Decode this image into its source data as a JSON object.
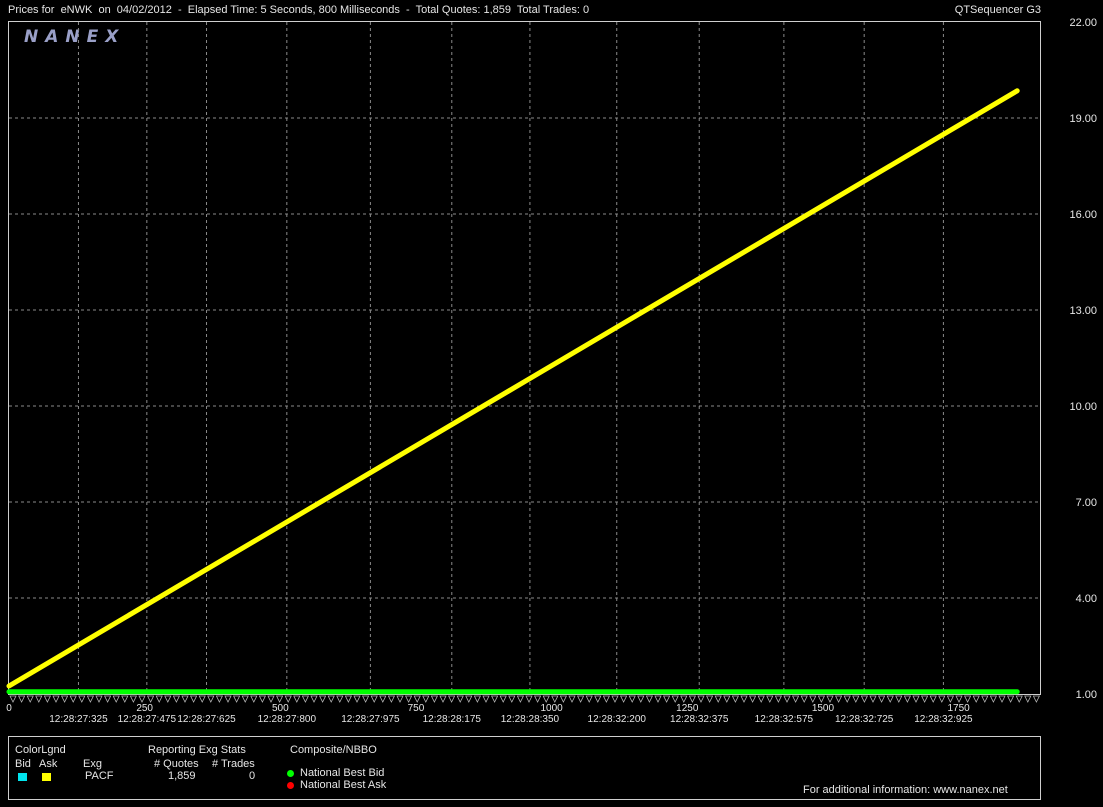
{
  "header": {
    "title": "Prices for  eNWK  on  04/02/2012  -  Elapsed Time: 5 Seconds, 800 Milliseconds  -  Total Quotes: 1,859  Total Trades: 0",
    "app_name": "QTSequencer G3"
  },
  "logo": "NANEX",
  "colors": {
    "ask": "#ffff00",
    "bid": "#00ff00",
    "grid": "#8a8a8a",
    "bid_swatch": "#00e5ee",
    "ask_swatch": "#ffff00",
    "nbb_dot": "#00ff00",
    "nba_dot": "#ff0000"
  },
  "chart_data": {
    "type": "line",
    "x_ticks": [
      0,
      250,
      500,
      750,
      1000,
      1250,
      1500,
      1750
    ],
    "time_labels": [
      {
        "x": 128,
        "label": "12:28:27:325"
      },
      {
        "x": 254,
        "label": "12:28:27:475"
      },
      {
        "x": 364,
        "label": "12:28:27:625"
      },
      {
        "x": 512,
        "label": "12:28:27:800"
      },
      {
        "x": 666,
        "label": "12:28:27:975"
      },
      {
        "x": 816,
        "label": "12:28:28:175"
      },
      {
        "x": 960,
        "label": "12:28:28:350"
      },
      {
        "x": 1120,
        "label": "12:28:32:200"
      },
      {
        "x": 1272,
        "label": "12:28:32:375"
      },
      {
        "x": 1428,
        "label": "12:28:32:575"
      },
      {
        "x": 1576,
        "label": "12:28:32:725"
      },
      {
        "x": 1722,
        "label": "12:28:32:925"
      }
    ],
    "y_ticks": [
      "1.00",
      "4.00",
      "7.00",
      "10.00",
      "13.00",
      "16.00",
      "19.00",
      "22.00"
    ],
    "xlim": [
      0,
      1900
    ],
    "ylim": [
      1,
      22
    ],
    "grid": true,
    "series": [
      {
        "name": "Ask",
        "x": [
          0,
          1858
        ],
        "values": [
          1.25,
          19.85
        ]
      },
      {
        "name": "Bid",
        "x": [
          0,
          1858
        ],
        "values": [
          1.07,
          1.07
        ]
      }
    ]
  },
  "legend": {
    "color_legend": "ColorLgnd",
    "bid": "Bid",
    "ask": "Ask",
    "exg_header": "Exg",
    "exchange": "PACF",
    "reporting_header": "Reporting Exg Stats",
    "quotes_header": "# Quotes",
    "trades_header": "# Trades",
    "quotes_value": "1,859",
    "trades_value": "0",
    "composite_header": "Composite/NBBO",
    "nbb": "National Best Bid",
    "nba": "National Best Ask",
    "info": "For additional information: www.nanex.net"
  }
}
